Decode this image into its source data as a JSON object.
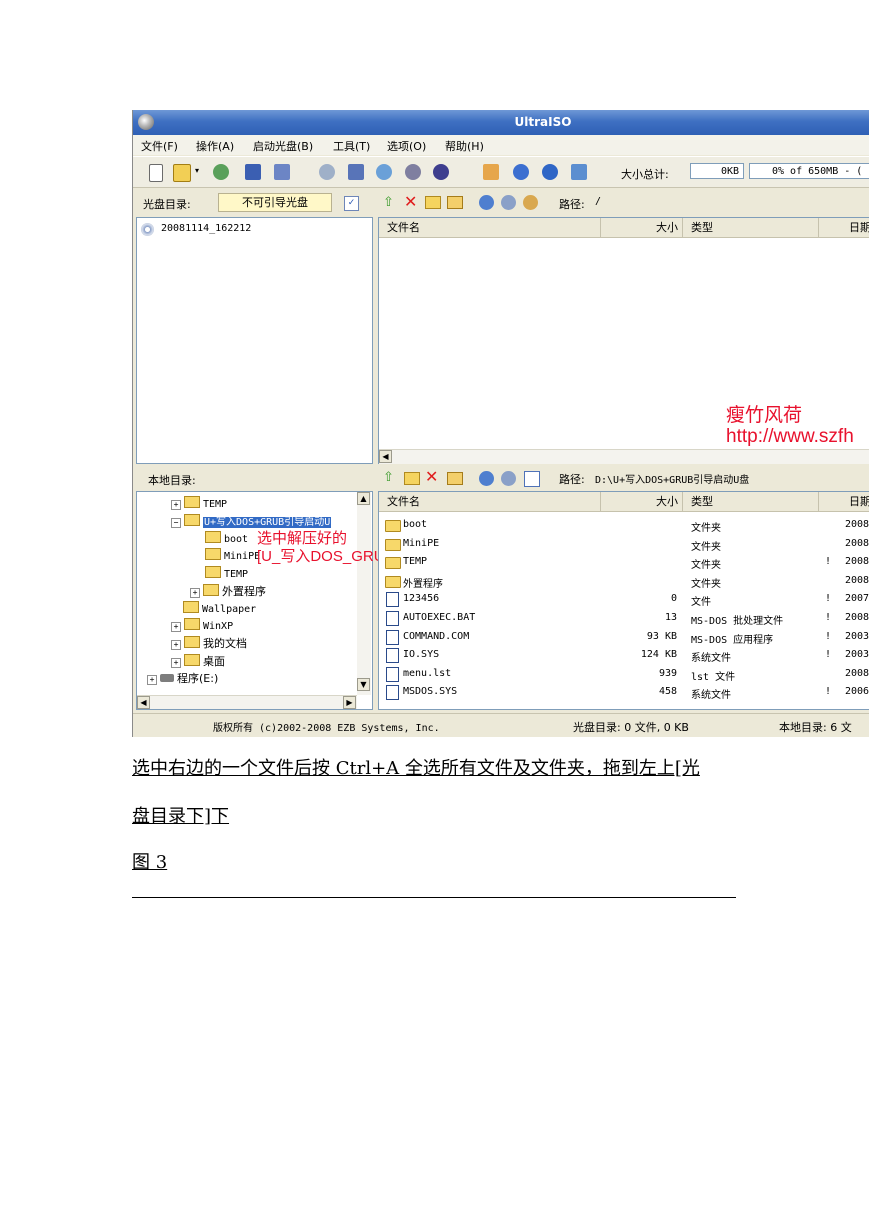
{
  "window": {
    "title": "UltraISO"
  },
  "menu": [
    "文件(F)",
    "操作(A)",
    "启动光盘(B)",
    "工具(T)",
    "选项(O)",
    "帮助(H)"
  ],
  "toolbar": {
    "size_label": "大小总计:",
    "size_value": "0KB",
    "capacity": "0% of 650MB - ("
  },
  "disc": {
    "label": "光盘目录:",
    "boot_type": "不可引导光盘",
    "path_label": "路径:",
    "path_value": "/",
    "root_node": "20081114_162212",
    "columns": [
      "文件名",
      "大小",
      "类型",
      "日期"
    ]
  },
  "local": {
    "label": "本地目录:",
    "path_label": "路径:",
    "path_value": "D:\\U+写入DOS+GRUB引导启动U盘",
    "tree": [
      "TEMP",
      "U+写入DOS+GRUB引导启动U",
      "boot",
      "MiniPE",
      "TEMP",
      "外置程序",
      "Wallpaper",
      "WinXP",
      "我的文档",
      "桌面",
      "程序(E:)"
    ],
    "columns": [
      "文件名",
      "大小",
      "类型",
      "日期"
    ],
    "files": [
      {
        "name": "boot",
        "size": "",
        "type": "文件夹",
        "flag": "",
        "date": "2008"
      },
      {
        "name": "MiniPE",
        "size": "",
        "type": "文件夹",
        "flag": "",
        "date": "2008"
      },
      {
        "name": "TEMP",
        "size": "",
        "type": "文件夹",
        "flag": "!",
        "date": "2008"
      },
      {
        "name": "外置程序",
        "size": "",
        "type": "文件夹",
        "flag": "",
        "date": "2008"
      },
      {
        "name": "123456",
        "size": "0",
        "type": "文件",
        "flag": "!",
        "date": "2007"
      },
      {
        "name": "AUTOEXEC.BAT",
        "size": "13",
        "type": "MS-DOS 批处理文件",
        "flag": "!",
        "date": "2008"
      },
      {
        "name": "COMMAND.COM",
        "size": "93 KB",
        "type": "MS-DOS 应用程序",
        "flag": "!",
        "date": "2003"
      },
      {
        "name": "IO.SYS",
        "size": "124 KB",
        "type": "系统文件",
        "flag": "!",
        "date": "2003"
      },
      {
        "name": "menu.lst",
        "size": "939",
        "type": "lst 文件",
        "flag": "",
        "date": "2008"
      },
      {
        "name": "MSDOS.SYS",
        "size": "458",
        "type": "系统文件",
        "flag": "!",
        "date": "2006"
      }
    ]
  },
  "status": {
    "copyright": "版权所有 (c)2002-2008 EZB Systems, Inc.",
    "disc": "光盘目录: 0 文件, 0 KB",
    "local": "本地目录: 6 文"
  },
  "annotations": {
    "watermark_name": "瘦竹风荷",
    "watermark_url": "http://www.szfh",
    "note_line1": "选中解压好的",
    "note_line2": "[U_写入DOS_GRUB引导启动U盘]文件夹"
  },
  "document": {
    "line1": "选中右边的一个文件后按 Ctrl+A 全选所有文件及文件夹，拖到左上[光",
    "line2": "盘目录下]下",
    "caption": "图 3"
  }
}
